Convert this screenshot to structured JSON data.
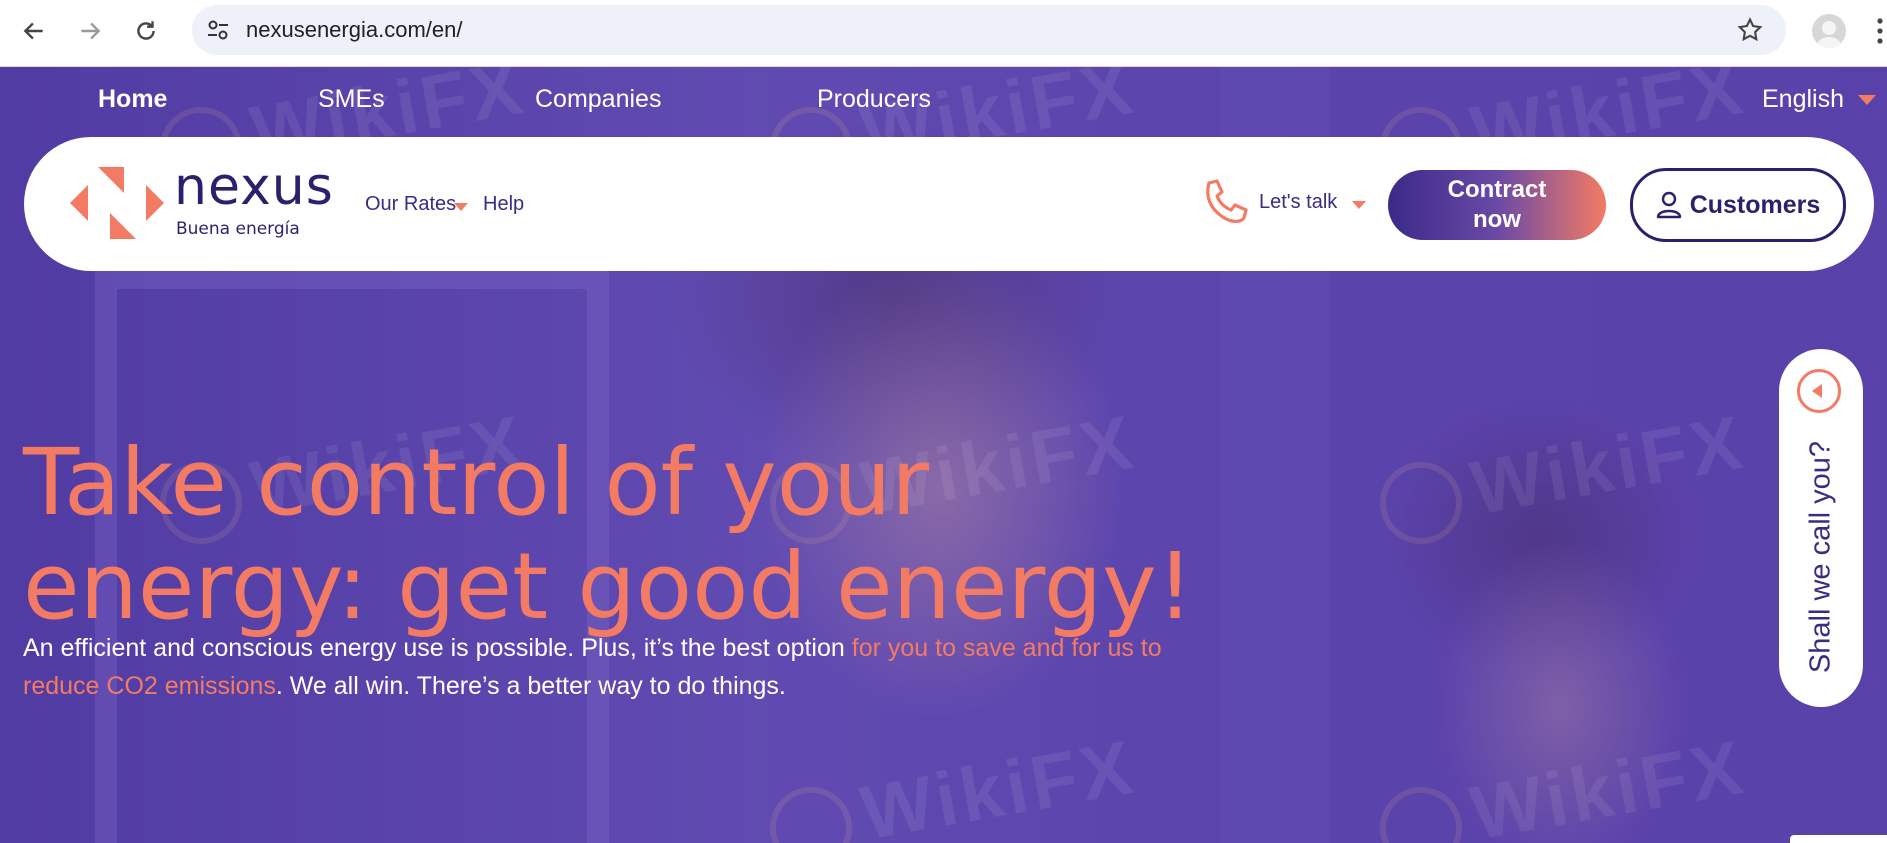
{
  "browser": {
    "url": "nexusenergia.com/en/"
  },
  "topnav": {
    "items": [
      {
        "label": "Home",
        "active": true
      },
      {
        "label": "SMEs"
      },
      {
        "label": "Companies"
      },
      {
        "label": "Producers"
      }
    ],
    "language": "English"
  },
  "header": {
    "logo_word": "nexus",
    "logo_tagline": "Buena energía",
    "menu": {
      "rates": "Our Rates",
      "help": "Help"
    },
    "talk": "Let's talk",
    "contract_line1": "Contract",
    "contract_line2": "now",
    "customers": "Customers"
  },
  "hero": {
    "headline_line1": "Take control of your",
    "headline_line2": "energy: get good energy!",
    "sub_part1": "An efficient and conscious energy use is possible. Plus, it’s the best option ",
    "sub_highlight": "for you to save and for us to reduce CO2 emissions",
    "sub_part2": ". We all win. There’s a better way to do things."
  },
  "callback": {
    "label": "Shall we call you?"
  },
  "watermark": {
    "text": "WikiFX"
  },
  "colors": {
    "brand_dark": "#2e1f6e",
    "accent": "#f47b63",
    "hero_tint": "#5b3fa6"
  }
}
